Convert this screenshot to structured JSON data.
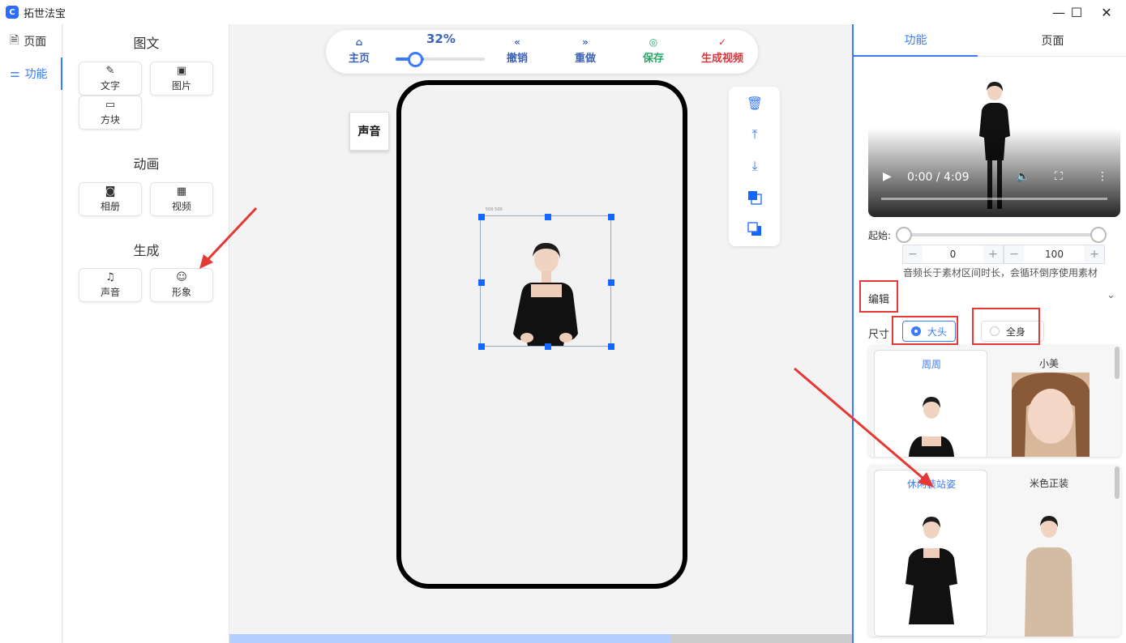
{
  "app": {
    "title": "拓世法宝",
    "icon_glyph": "C"
  },
  "window_controls": {
    "minimize": "—",
    "maximize": "☐",
    "close": "✕"
  },
  "nav": {
    "items": [
      {
        "label": "页面"
      },
      {
        "label": "功能"
      }
    ]
  },
  "tools": {
    "sections": [
      {
        "title": "图文",
        "buttons": [
          {
            "label": "文字",
            "icon": "edit-icon"
          },
          {
            "label": "图片",
            "icon": "image-icon"
          },
          {
            "label": "方块",
            "icon": "board-icon"
          }
        ]
      },
      {
        "title": "动画",
        "buttons": [
          {
            "label": "相册",
            "icon": "camera-icon"
          },
          {
            "label": "视频",
            "icon": "film-icon"
          }
        ]
      },
      {
        "title": "生成",
        "buttons": [
          {
            "label": "声音",
            "icon": "headphones-icon"
          },
          {
            "label": "形象",
            "icon": "person-icon"
          }
        ]
      }
    ]
  },
  "toolbar": {
    "home": "主页",
    "zoom": "32%",
    "zoom_value": 0.32,
    "undo": "撤销",
    "redo": "重做",
    "save": "保存",
    "generate": "生成视频",
    "colors": {
      "primary": "#3d63b8",
      "save": "#27a866",
      "generate": "#e5323a"
    }
  },
  "canvas": {
    "audio_tag": "声音",
    "selection_label": "500 500"
  },
  "side_tools": [
    "trash-icon",
    "align-top-icon",
    "align-bottom-icon",
    "bring-front-icon",
    "send-back-icon"
  ],
  "right": {
    "tabs": [
      {
        "label": "功能"
      },
      {
        "label": "页面"
      }
    ],
    "video": {
      "time": "0:00 / 4:09"
    },
    "range": {
      "label": "起始:",
      "start": "0",
      "end": "100"
    },
    "hint": "音频长于素材区间时长，会循环倒序使用素材",
    "edit": {
      "title": "编辑"
    },
    "size": {
      "label": "尺寸",
      "options": [
        {
          "label": "大头",
          "selected": true
        },
        {
          "label": "全身",
          "selected": false
        }
      ]
    },
    "avatars_row1": [
      {
        "name": "周周"
      },
      {
        "name": "小美"
      }
    ],
    "avatars_row2": [
      {
        "name": "休闲装站姿"
      },
      {
        "name": "米色正装"
      }
    ]
  },
  "colors": {
    "accent": "#3a7afe",
    "annotation_red": "#e53935"
  }
}
